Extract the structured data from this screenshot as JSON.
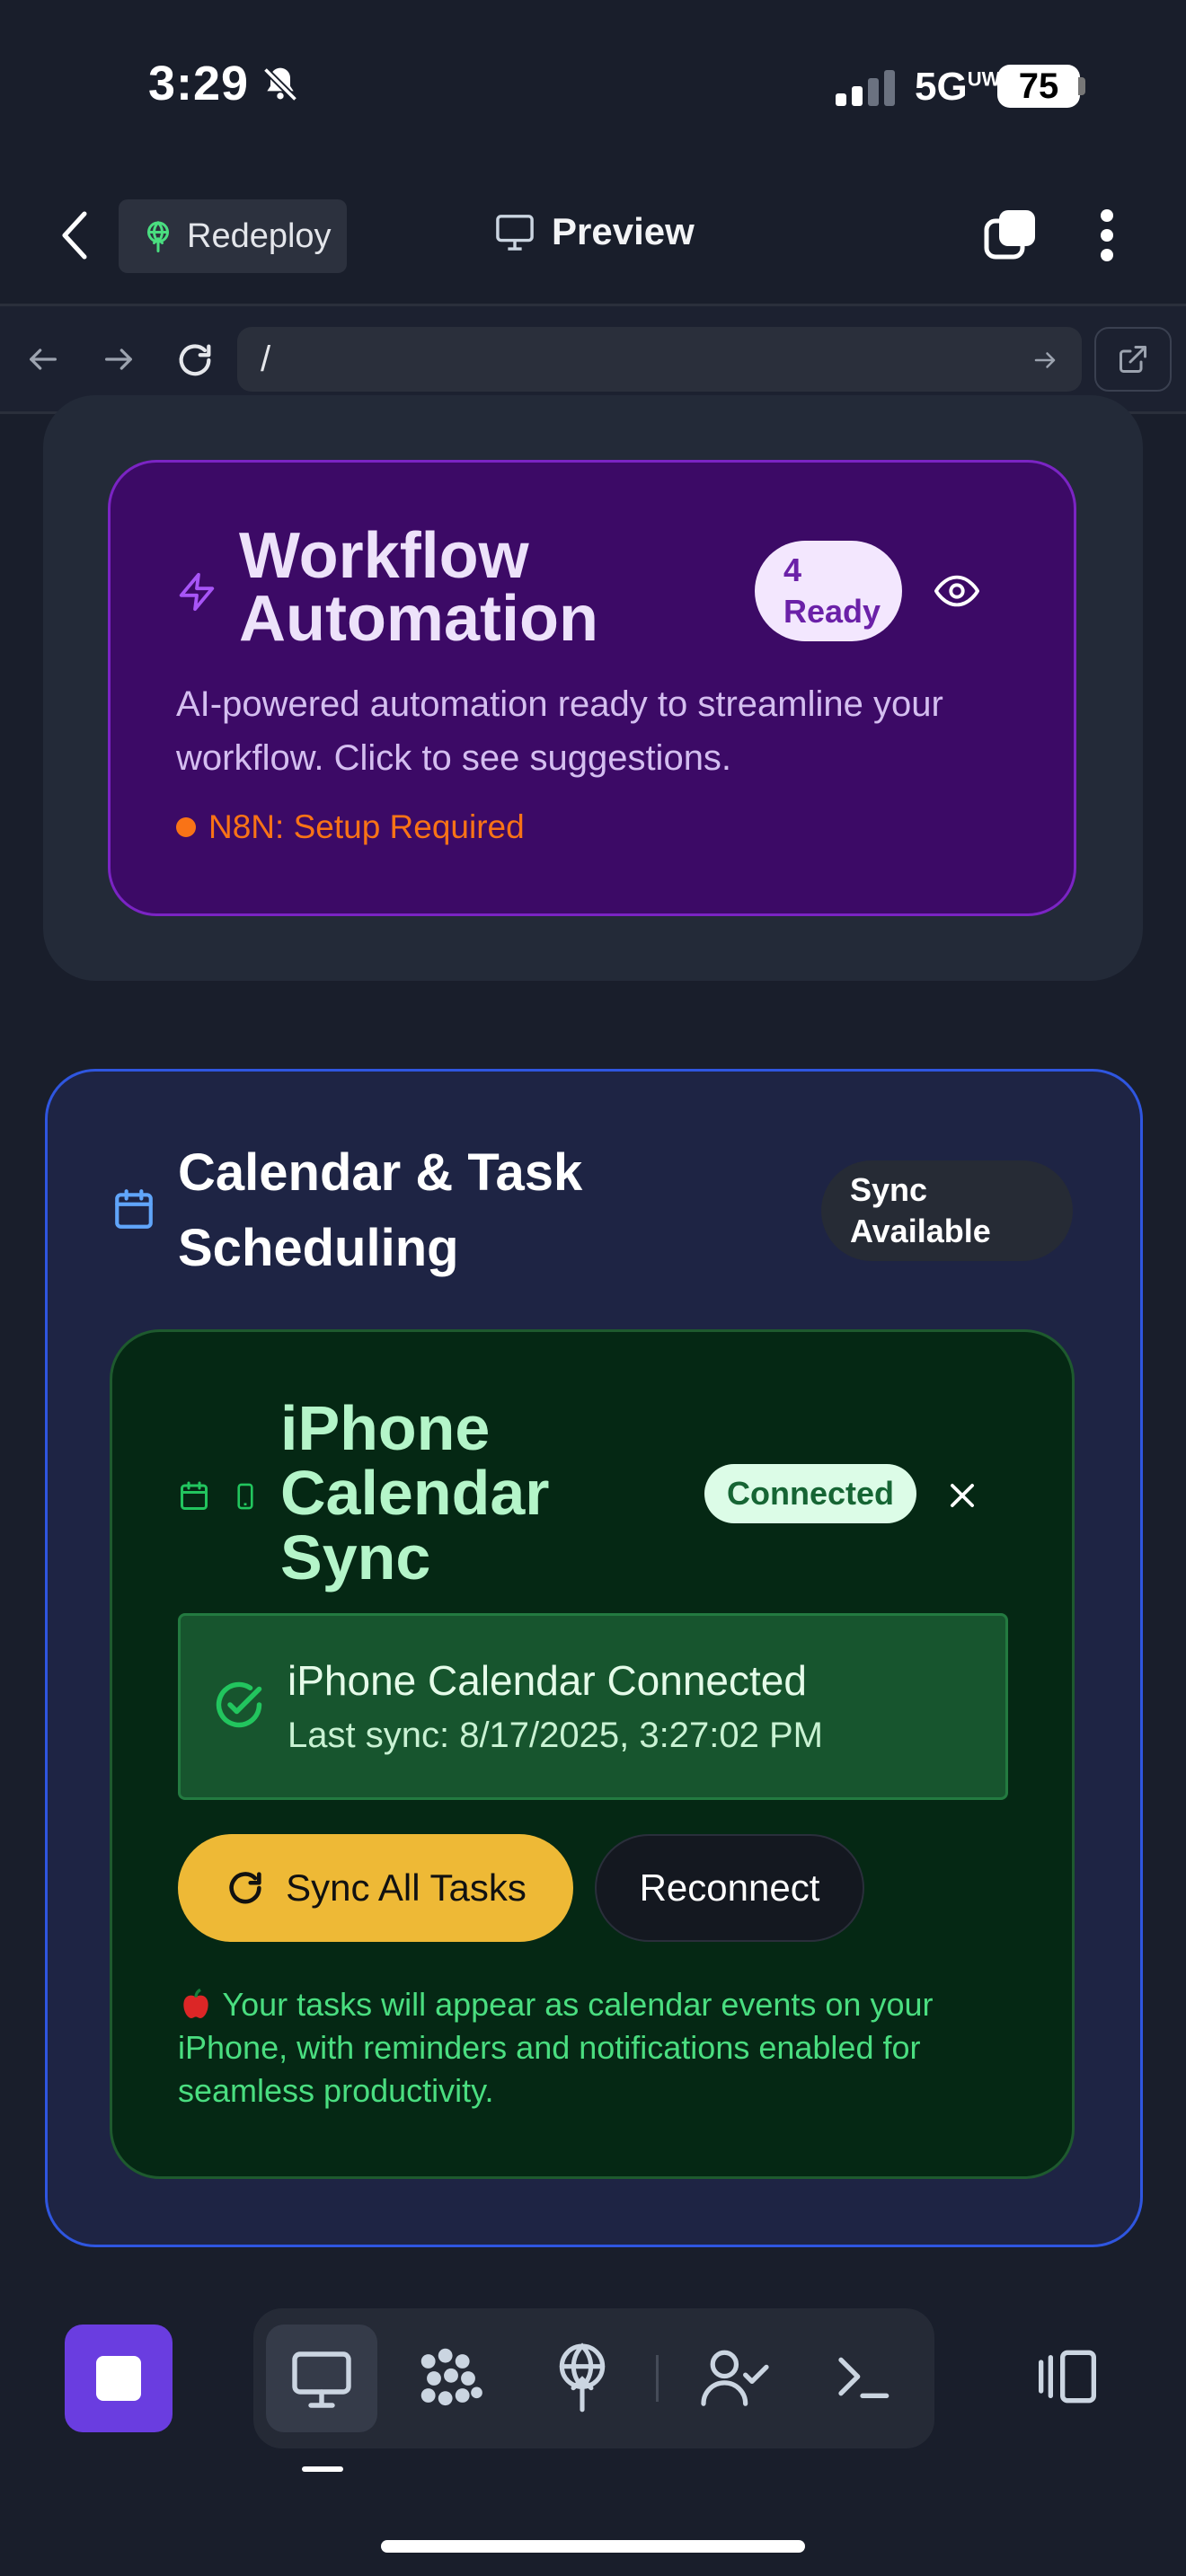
{
  "status_bar": {
    "time": "3:29",
    "network": "5G",
    "network_sup": "UW",
    "battery": "75"
  },
  "header": {
    "redeploy_label": "Redeploy",
    "preview_label": "Preview"
  },
  "url_bar": {
    "path": "/"
  },
  "workflow": {
    "title": "Workflow Automation",
    "ready_badge": "4 Ready",
    "description": "AI-powered automation ready to streamline your workflow. Click to see suggestions.",
    "n8n_status": "N8N: Setup Required"
  },
  "calendar": {
    "title": "Calendar & Task Scheduling",
    "sync_badge": "Sync Available",
    "iphone": {
      "title": "iPhone Calendar Sync",
      "status_badge": "Connected",
      "connected_title": "iPhone Calendar Connected",
      "last_sync": "Last sync: 8/17/2025, 3:27:02 PM",
      "sync_button": "Sync All Tasks",
      "reconnect_button": "Reconnect",
      "info": "Your tasks will appear as calendar events on your iPhone, with reminders and notifications enabled for seamless productivity."
    }
  },
  "colors": {
    "background": "#191e2b",
    "workflow_card": "#3c0a66",
    "calendar_card_border": "#2f56e0",
    "iphone_card": "#052814",
    "sync_button": "#eeb936",
    "status_orange": "#f97316",
    "stop_button": "#6a3de0"
  },
  "icons": {
    "toolbar": [
      "desktop-icon",
      "grid-icon",
      "deploy-icon",
      "user-check-icon",
      "terminal-icon",
      "panel-icon"
    ]
  }
}
